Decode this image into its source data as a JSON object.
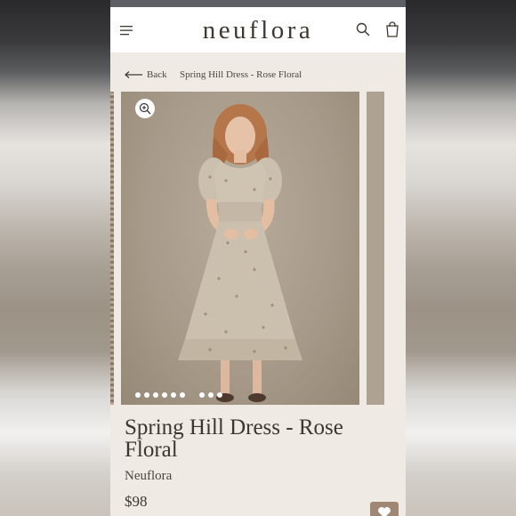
{
  "header": {
    "brand": "neuflora",
    "menu_icon": "hamburger-menu-icon",
    "search_icon": "search-icon",
    "bag_icon": "shopping-bag-icon"
  },
  "breadcrumb": {
    "back_label": "Back",
    "current": "Spring Hill Dress - Rose Floral"
  },
  "gallery": {
    "zoom_icon": "zoom-in-icon",
    "dot_count": 9,
    "active_dot": 1
  },
  "product": {
    "title": "Spring Hill Dress - Rose Floral",
    "vendor": "Neuflora",
    "price": "$98"
  },
  "colors": {
    "accent": "#9f8774",
    "background": "#efebe4",
    "text": "#3b372f"
  }
}
